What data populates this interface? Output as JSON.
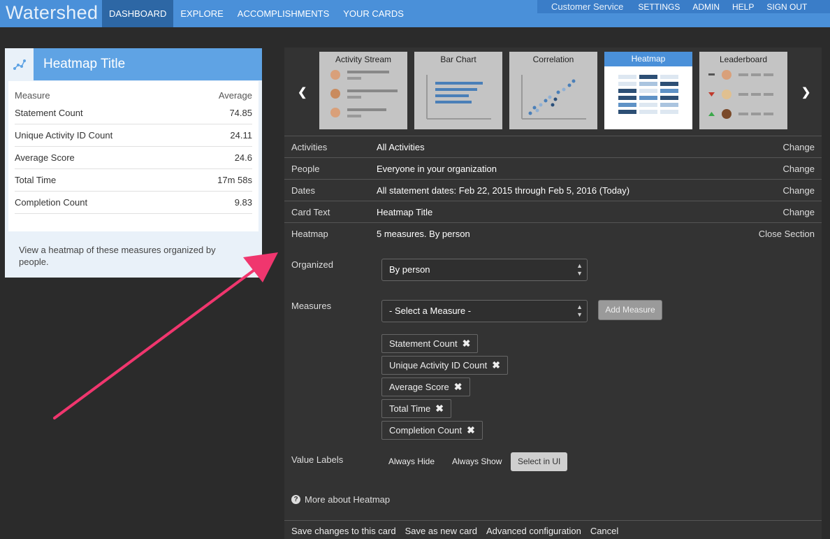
{
  "brand": "Watershed",
  "nav": {
    "left": [
      "DASHBOARD",
      "EXPLORE",
      "ACCOMPLISHMENTS",
      "YOUR CARDS"
    ],
    "right": [
      "Customer Service",
      "SETTINGS",
      "ADMIN",
      "HELP",
      "SIGN OUT"
    ]
  },
  "card": {
    "title": "Heatmap Title",
    "headers": [
      "Measure",
      "Average"
    ],
    "rows": [
      {
        "measure": "Statement Count",
        "value": "74.85"
      },
      {
        "measure": "Unique Activity ID Count",
        "value": "24.11"
      },
      {
        "measure": "Average Score",
        "value": "24.6"
      },
      {
        "measure": "Total Time",
        "value": "17m 58s"
      },
      {
        "measure": "Completion Count",
        "value": "9.83"
      }
    ],
    "description": "View a heatmap of these measures organized by people."
  },
  "carousel": {
    "prev_icon": "chevron-left-icon",
    "next_icon": "chevron-right-icon",
    "items": [
      "Activity Stream",
      "Bar Chart",
      "Correlation",
      "Heatmap",
      "Leaderboard"
    ],
    "selected": "Heatmap"
  },
  "fields": [
    {
      "label": "Activities",
      "value": "All Activities",
      "action": "Change"
    },
    {
      "label": "People",
      "value": "Everyone in your organization",
      "action": "Change"
    },
    {
      "label": "Dates",
      "value": "All statement dates: Feb 22, 2015 through Feb 5, 2016 (Today)",
      "action": "Change"
    },
    {
      "label": "Card Text",
      "value": "Heatmap Title",
      "action": "Change"
    },
    {
      "label": "Heatmap",
      "value": "5 measures. By person",
      "action": "Close Section"
    }
  ],
  "heatmap_section": {
    "organized_label": "Organized",
    "organized_value": "By person",
    "measures_label": "Measures",
    "measure_select_placeholder": "- Select a Measure -",
    "add_measure_label": "Add Measure",
    "measures": [
      "Statement Count",
      "Unique Activity ID Count",
      "Average Score",
      "Total Time",
      "Completion Count"
    ],
    "value_labels_label": "Value Labels",
    "value_label_options": [
      "Always Hide",
      "Always Show",
      "Select in UI"
    ],
    "value_label_selected": "Select in UI",
    "more_link": "More about Heatmap"
  },
  "footer": [
    "Save changes to this card",
    "Save as new card",
    "Advanced configuration",
    "Cancel"
  ],
  "colors": {
    "topbar": "#4a90d9",
    "nav_active": "#2d67a5",
    "card_header": "#5fa3e4",
    "annotation_arrow": "#f0366e"
  }
}
